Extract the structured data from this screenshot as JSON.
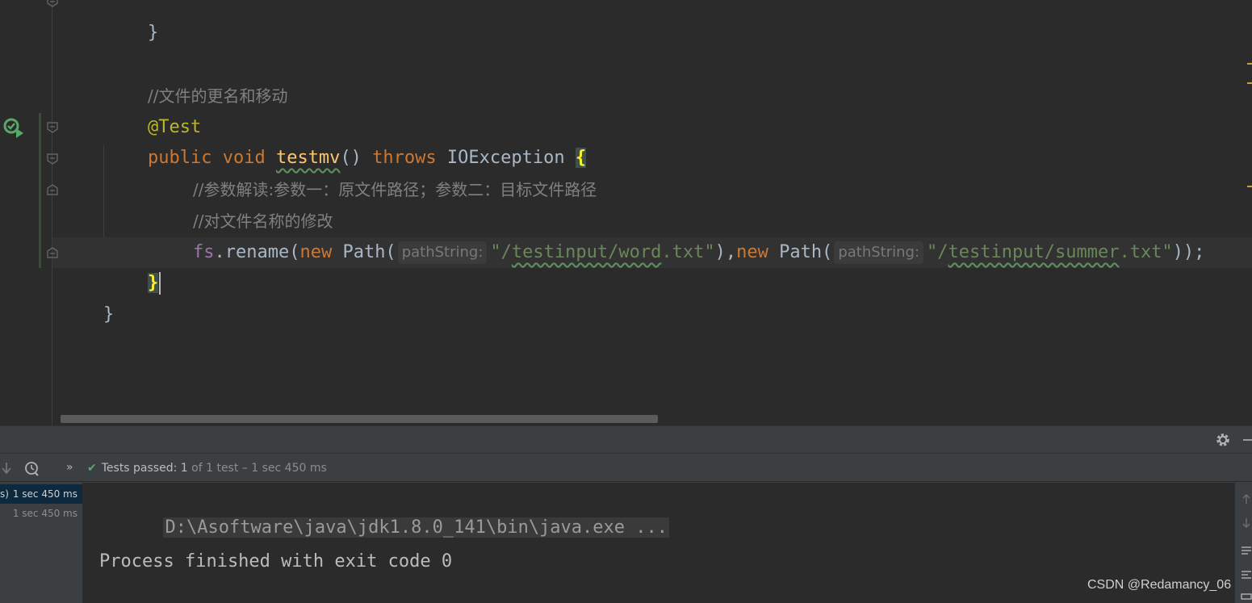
{
  "editor": {
    "lines": {
      "closing_brace_top": "}",
      "comment_rename_move": "//文件的更名和移动",
      "annotation": "@Test",
      "kw_public": "public",
      "kw_void": "void",
      "method_name": "testmv",
      "parens": "()",
      "kw_throws": "throws",
      "exception": "IOException",
      "open_brace": "{",
      "comment_params": "//参数解读:参数一：原文件路径；参数二：目标文件路径",
      "comment_rename_name": "//对文件名称的修改",
      "field_fs": "fs",
      "call_rename": ".rename(",
      "kw_new": "new",
      "class_path": "Path(",
      "hint_path_string": "pathString:",
      "str_word_quote_open": "\"/",
      "str_word_squiggle": "testinput/word",
      "str_word_rest": ".txt\"",
      "sep_close_comma": "),",
      "str_summer_quote_open": "\"/",
      "str_summer_squiggle": "testinput/summer",
      "str_summer_rest": ".txt\"",
      "call_end": "));",
      "method_close_brace": "}",
      "class_close_brace": "}"
    }
  },
  "run_panel": {
    "toolbar": {
      "more_label": "»",
      "status_label": "Tests passed:",
      "status_count": "1",
      "status_detail": "of 1 test – 1 sec 450 ms"
    },
    "tree": {
      "row1_edge": "s)",
      "row1_time": "1 sec 450 ms",
      "row2_time": "1 sec 450 ms"
    },
    "console": {
      "command": "D:\\Asoftware\\java\\jdk1.8.0_141\\bin\\java.exe ...",
      "exit_message": "Process finished with exit code 0"
    }
  },
  "watermark": "CSDN @Redamancy_06",
  "colors": {
    "background": "#2b2b2b",
    "keyword": "#cc7832",
    "string": "#6a8759",
    "comment": "#808080",
    "annotation": "#bbb529",
    "method": "#ffc66d",
    "field": "#9876aa",
    "success": "#59a869"
  }
}
